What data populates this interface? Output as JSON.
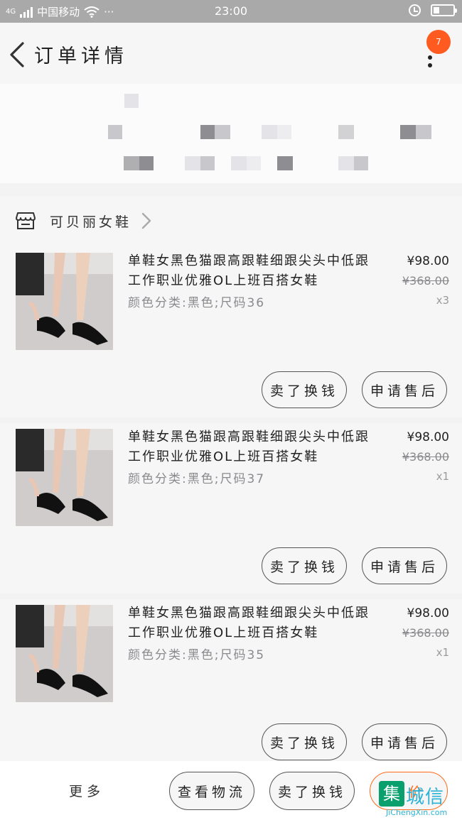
{
  "status_bar": {
    "network": "4G",
    "carrier": "中国移动",
    "more": "···",
    "time": "23:00"
  },
  "header": {
    "title": "订单详情",
    "badge_count": "7"
  },
  "shop": {
    "name": "可贝丽女鞋"
  },
  "items": [
    {
      "title": "单鞋女黑色猫跟高跟鞋细跟尖头中低跟工作职业优雅OL上班百搭女鞋",
      "spec": "颜色分类:黑色;尺码36",
      "price": "¥98.00",
      "original_price": "¥368.00",
      "quantity": "x3",
      "btn_exchange": "卖了换钱",
      "btn_aftersale": "申请售后"
    },
    {
      "title": "单鞋女黑色猫跟高跟鞋细跟尖头中低跟工作职业优雅OL上班百搭女鞋",
      "spec": "颜色分类:黑色;尺码37",
      "price": "¥98.00",
      "original_price": "¥368.00",
      "quantity": "x1",
      "btn_exchange": "卖了换钱",
      "btn_aftersale": "申请售后"
    },
    {
      "title": "单鞋女黑色猫跟高跟鞋细跟尖头中低跟工作职业优雅OL上班百搭女鞋",
      "spec": "颜色分类:黑色;尺码35",
      "price": "¥98.00",
      "original_price": "¥368.00",
      "quantity": "x1",
      "btn_exchange": "卖了换钱",
      "btn_aftersale": "申请售后"
    }
  ],
  "bottom_bar": {
    "more_label": "更多",
    "logistics_label": "查看物流",
    "exchange_label": "卖了换钱",
    "primary_label": "评价"
  },
  "watermark": {
    "logo_char": "集",
    "text": "城信",
    "url": "JiChengXin.com"
  },
  "colors": {
    "accent": "#ff6a1a",
    "badge": "#ff5a1f",
    "status_bar": "#a9a9aa"
  }
}
